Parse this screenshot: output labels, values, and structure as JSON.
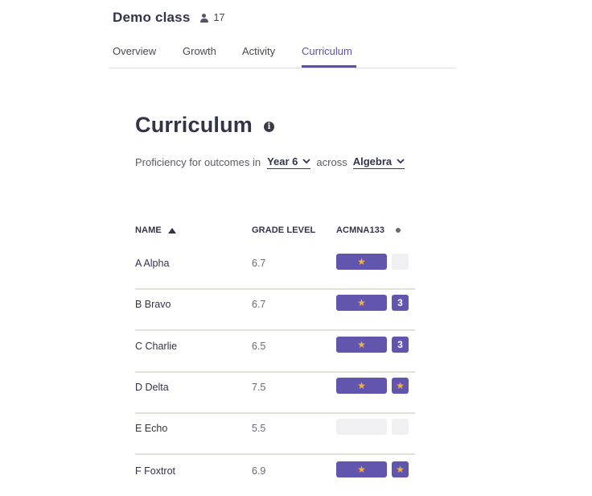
{
  "header": {
    "class_name": "Demo class",
    "student_count": "17"
  },
  "tabs": [
    {
      "label": "Overview"
    },
    {
      "label": "Growth"
    },
    {
      "label": "Activity"
    },
    {
      "label": "Curriculum",
      "active": true
    }
  ],
  "page": {
    "title": "Curriculum"
  },
  "filters": {
    "prefix": "Proficiency for outcomes in",
    "year": "Year 6",
    "connector": "across",
    "strand": "Algebra"
  },
  "table": {
    "columns": {
      "name": "NAME",
      "grade": "GRADE LEVEL",
      "outcome": "ACMNA133"
    },
    "rows": [
      {
        "name": "A Alpha",
        "grade": "6.7",
        "bar": "star",
        "box": ""
      },
      {
        "name": "B Bravo",
        "grade": "6.7",
        "bar": "star",
        "box": "3"
      },
      {
        "name": "C Charlie",
        "grade": "6.5",
        "bar": "star",
        "box": "3"
      },
      {
        "name": "D Delta",
        "grade": "7.5",
        "bar": "star",
        "box": "star"
      },
      {
        "name": "E Echo",
        "grade": "5.5",
        "bar": "empty",
        "box": ""
      },
      {
        "name": "F Foxtrot",
        "grade": "6.9",
        "bar": "star",
        "box": "star"
      }
    ]
  },
  "colors": {
    "accent": "#5d4fae",
    "bar_fill": "#6155ad",
    "star": "#f2b53a",
    "empty": "#f0f0f2"
  }
}
